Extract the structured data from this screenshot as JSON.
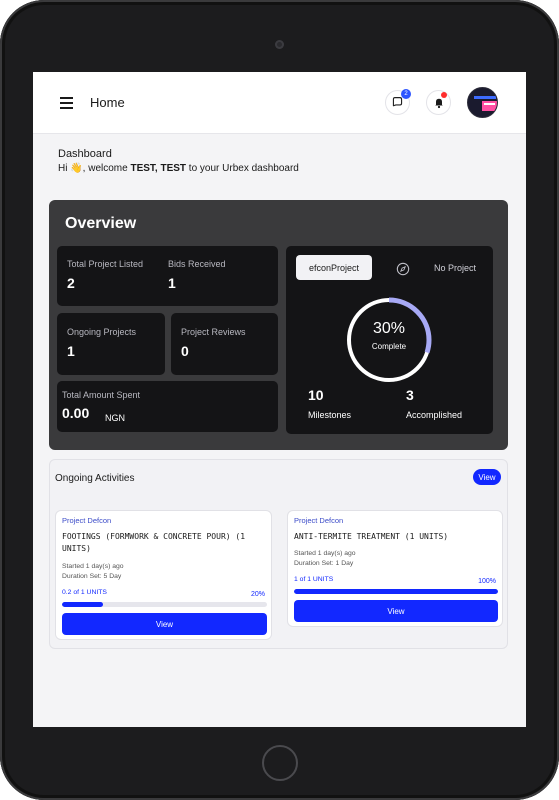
{
  "header": {
    "title": "Home",
    "chat_badge": "2",
    "icons": [
      "menu-icon",
      "chat-icon",
      "bell-icon",
      "avatar"
    ]
  },
  "dashboard": {
    "title": "Dashboard",
    "greet_prefix": "Hi 👋, welcome ",
    "greet_name": "TEST, TEST",
    "greet_suffix": " to your Urbex dashboard"
  },
  "overview": {
    "title": "Overview",
    "total_project_listed_label": "Total Project Listed",
    "total_project_listed_value": "2",
    "bids_received_label": "Bids Received",
    "bids_received_value": "1",
    "ongoing_projects_label": "Ongoing Projects",
    "ongoing_projects_value": "1",
    "project_reviews_label": "Project Reviews",
    "project_reviews_value": "0",
    "total_amount_label": "Total Amount Spent",
    "total_amount_value": "0.00",
    "total_amount_currency": "NGN",
    "project_selector": "efconProject",
    "no_project": "No Project",
    "progress_percent_text": "30%",
    "progress_fraction": 0.3,
    "progress_label": "Complete",
    "milestones_value": "10",
    "milestones_label": "Milestones",
    "accomplished_value": "3",
    "accomplished_label": "Accomplished"
  },
  "ongoing": {
    "title": "Ongoing Activities",
    "view_label": "View",
    "activities": [
      {
        "project": "Project Defcon",
        "name": "FOOTINGS (FORMWORK & CONCRETE POUR) (1 UNITS)",
        "started": "Started 1 day(s) ago",
        "duration": "Duration Set: 5 Day",
        "units": "0.2 of 1 UNITS",
        "percent_text": "20%",
        "progress": 0.2,
        "button": "View"
      },
      {
        "project": "Project Defcon",
        "name": "ANTI-TERMITE TREATMENT (1 UNITS)",
        "started": "Started 1 day(s) ago",
        "duration": "Duration Set: 1 Day",
        "units": "1 of 1 UNITS",
        "percent_text": "100%",
        "progress": 1.0,
        "button": "View"
      }
    ]
  },
  "colors": {
    "accent": "#1228ff",
    "overview_bg": "#3a3a3c",
    "stat_box_bg": "#141416",
    "ring_track": "#ffffff",
    "ring_progress": "#a7a9f5"
  }
}
